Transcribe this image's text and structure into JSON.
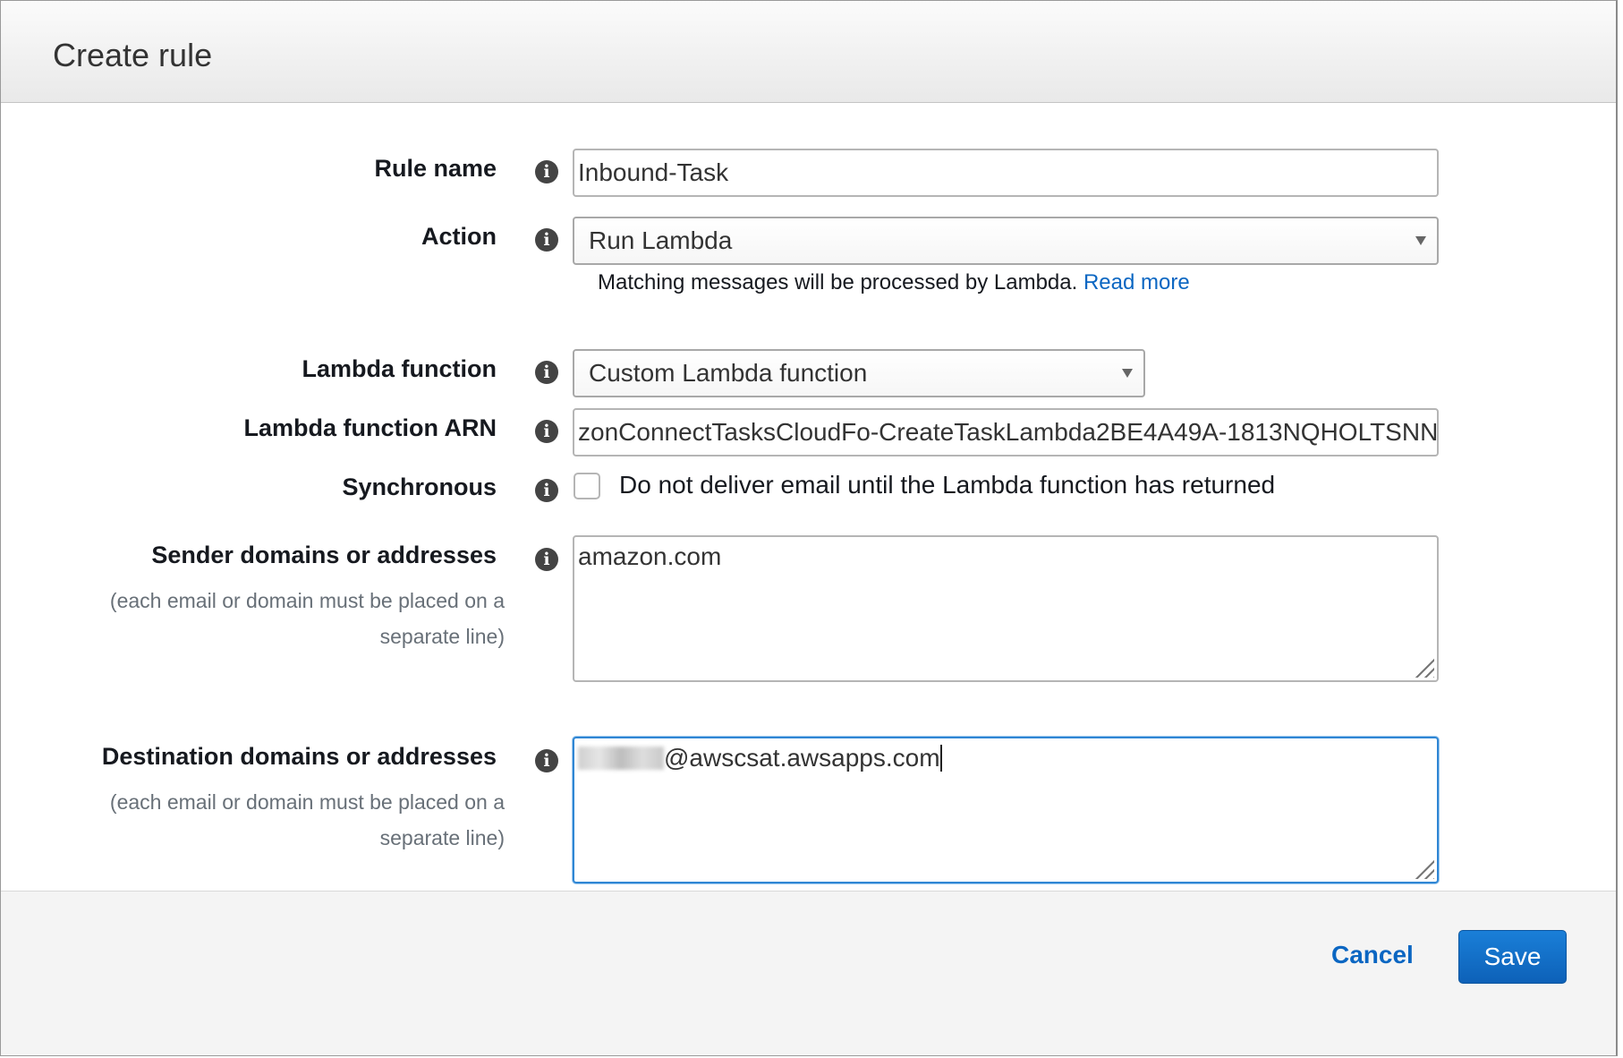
{
  "dialog": {
    "title": "Create rule"
  },
  "form": {
    "rule_name": {
      "label": "Rule name",
      "value": "Inbound-Task"
    },
    "action": {
      "label": "Action",
      "selected": "Run Lambda",
      "help_text": "Matching messages will be processed by Lambda.",
      "help_link": "Read more"
    },
    "lambda_function": {
      "label": "Lambda function",
      "selected": "Custom Lambda function"
    },
    "lambda_arn": {
      "label": "Lambda function ARN",
      "value": "zonConnectTasksCloudFo-CreateTaskLambda2BE4A49A-1813NQHOLTSNN"
    },
    "synchronous": {
      "label": "Synchronous",
      "checkbox_label": "Do not deliver email until the Lambda function has returned",
      "checked": false
    },
    "sender": {
      "label": "Sender domains or addresses",
      "hint_line1": "(each email or domain must be placed on a",
      "hint_line2": "separate line)",
      "value": "amazon.com"
    },
    "destination": {
      "label": "Destination domains or addresses",
      "hint_line1": "(each email or domain must be placed on a",
      "hint_line2": "separate line)",
      "value_visible": "@awscsat.awsapps.com"
    }
  },
  "footer": {
    "cancel_label": "Cancel",
    "save_label": "Save"
  },
  "colors": {
    "primary": "#0d6ec7",
    "link": "#0a66c2",
    "focus": "#2f86d4"
  },
  "icons": {
    "info": "info-icon",
    "caret": "chevron-down-icon",
    "resize": "resize-grip-icon"
  }
}
